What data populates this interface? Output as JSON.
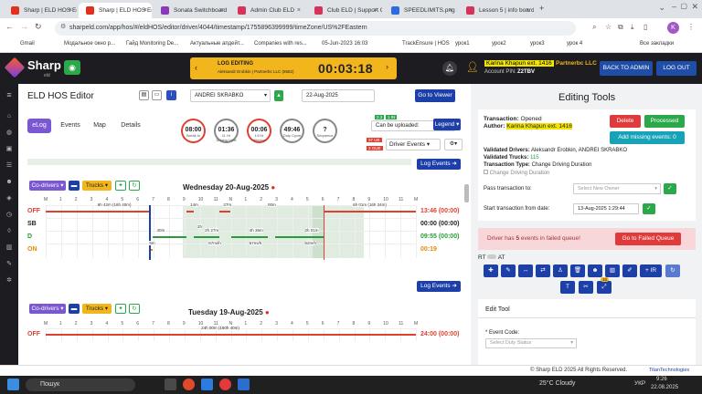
{
  "browser": {
    "tabs": [
      {
        "label": "Sharp | ELD HOS Edit",
        "color": "#e0301e"
      },
      {
        "label": "Sharp | ELD HOS Edit",
        "color": "#e0301e",
        "active": true
      },
      {
        "label": "Sonata Switchboard",
        "color": "#8a3ab9"
      },
      {
        "label": "Admin Club ELD",
        "color": "#d4335a"
      },
      {
        "label": "Club ELD | Support C",
        "color": "#d4335a"
      },
      {
        "label": "SPEEDLIMITS.png (77",
        "color": "#2d6cdf"
      },
      {
        "label": "Lesson 5 | info board",
        "color": "#d4335a"
      }
    ],
    "url": "sharpeld.com/app/hos/#/eldHOS/editor/driver/4044/timestamp/1755896399999/timeZone/US%2FEastern",
    "bookmarks": [
      "Gmail",
      "Модальное окно р...",
      "Гайд Monitoring De...",
      "Актуальные апдейт...",
      "Companies with res...",
      "05-Jun-2023 16:03",
      "TrackEnsure | HOS",
      "урок1",
      "урок2",
      "урок3",
      "урок 4",
      "Все закладки"
    ]
  },
  "app": {
    "brand": "Sharp",
    "brand_sub": "eld",
    "log_editing": "LOG EDITING",
    "log_editing_sub": "Aleksandr Erobkin | Partnerbc LLC (8582)",
    "timer": "00:03:18",
    "user_name": "Karina Khapun ext. 1416",
    "company": "Partnerbc LLC",
    "account_pin_label": "Account PIN:",
    "account_pin": "Z2TBV",
    "back_to_admin": "BACK TO ADMIN",
    "logout": "LOG OUT"
  },
  "editor": {
    "title": "ELD HOS Editor",
    "driver": "ANDREI SKRABKO",
    "date": "22-Aug-2025",
    "go_to_viewer": "Go to Viewer",
    "tabs": [
      "eLog",
      "Events",
      "Map",
      "Details"
    ],
    "circles": [
      {
        "value": "08:00",
        "label": "Break in"
      },
      {
        "value": "01:36",
        "label": "11 Hr Driving Limit"
      },
      {
        "value": "00:06",
        "label": "14 Hr Window"
      },
      {
        "value": "49:46",
        "label": "Duty Cycle"
      },
      {
        "value": "?",
        "label": "Sequence"
      }
    ],
    "can_be_uploaded": "Can be uploaded:",
    "legend": "Legend",
    "driver_events": "Driver Events",
    "badge_ue": "37 UE",
    "badge_oue": "3 OUE",
    "badge1": "2.3",
    "badge2": "1 IN",
    "log_events": "Log Events",
    "co_drivers": "Co-drivers",
    "trucks": "Trucks",
    "day1": {
      "title": "Wednesday 20-Aug-2025",
      "rows": [
        {
          "label": "OFF",
          "total": "13:46 (00:00)",
          "color": "#e04030"
        },
        {
          "label": "SB",
          "total": "00:00 (00:00)",
          "color": "#222"
        },
        {
          "label": "D",
          "total": "09:55 (00:00)",
          "color": "#2a9a3a"
        },
        {
          "label": "ON",
          "total": "00:19",
          "color": "#e38a00"
        }
      ],
      "notes": [
        "6h 42m (16h 40m)",
        "14m",
        "27m",
        "00m",
        "6h 01m (16h 34m)",
        "40m",
        "2h 27m",
        "4h 36m",
        "2h 01m",
        "5m",
        "2h",
        "67mi/h",
        "57mi/h",
        "52m/h"
      ]
    },
    "day2": {
      "title": "Tuesday 19-Aug-2025",
      "rows": [
        {
          "label": "OFF",
          "total": "24:00 (00:00)",
          "color": "#e04030"
        }
      ],
      "notes": [
        "24h 00m (160h 40m)"
      ]
    },
    "hours": [
      "M",
      "1",
      "2",
      "3",
      "4",
      "5",
      "6",
      "7",
      "8",
      "9",
      "10",
      "11",
      "N",
      "1",
      "2",
      "3",
      "4",
      "5",
      "6",
      "7",
      "8",
      "9",
      "10",
      "11",
      "M"
    ]
  },
  "tools": {
    "title": "Editing Tools",
    "transaction_label": "Transaction:",
    "transaction": "Opened",
    "author_label": "Author:",
    "author": "Karina Khapun ext. 1416",
    "delete": "Delete",
    "processed": "Processed",
    "add_missing": "Add missing events: 0",
    "validated_drivers_label": "Validated Drivers:",
    "validated_drivers": "Aleksandr Erobkin, ANDREI SKRABKO",
    "validated_trucks_label": "Validated Trucks:",
    "validated_trucks": "115",
    "transaction_type_label": "Transaction Type:",
    "transaction_type": "Change Driving Duration",
    "change_driving": "Change Driving Duration",
    "pass_label": "Pass transaction to:",
    "pass_placeholder": "Select New Owner",
    "start_label": "Start transaction from date:",
    "start_value": "13-Aug-2025 1:29:44",
    "failed_text_pre": "Driver has ",
    "failed_count": "5",
    "failed_text_post": " events in failed queue!",
    "go_failed": "Go to Failed Queue",
    "rt": "RT",
    "at": "AT",
    "ir": "+ IR",
    "badge_count": "16",
    "edit_tool": "Edit Tool",
    "event_code": "* Event Code:",
    "event_code_placeholder": "Select Duty Status"
  },
  "footer": {
    "copyright": "© Sharp ELD  2025 All Rights Reserved.",
    "titan": "TitanTechnologies"
  },
  "taskbar": {
    "search": "Пошук",
    "weather": "25°C  Cloudy",
    "lang": "УКР",
    "time": "9:26",
    "date": "22.08.2025"
  }
}
